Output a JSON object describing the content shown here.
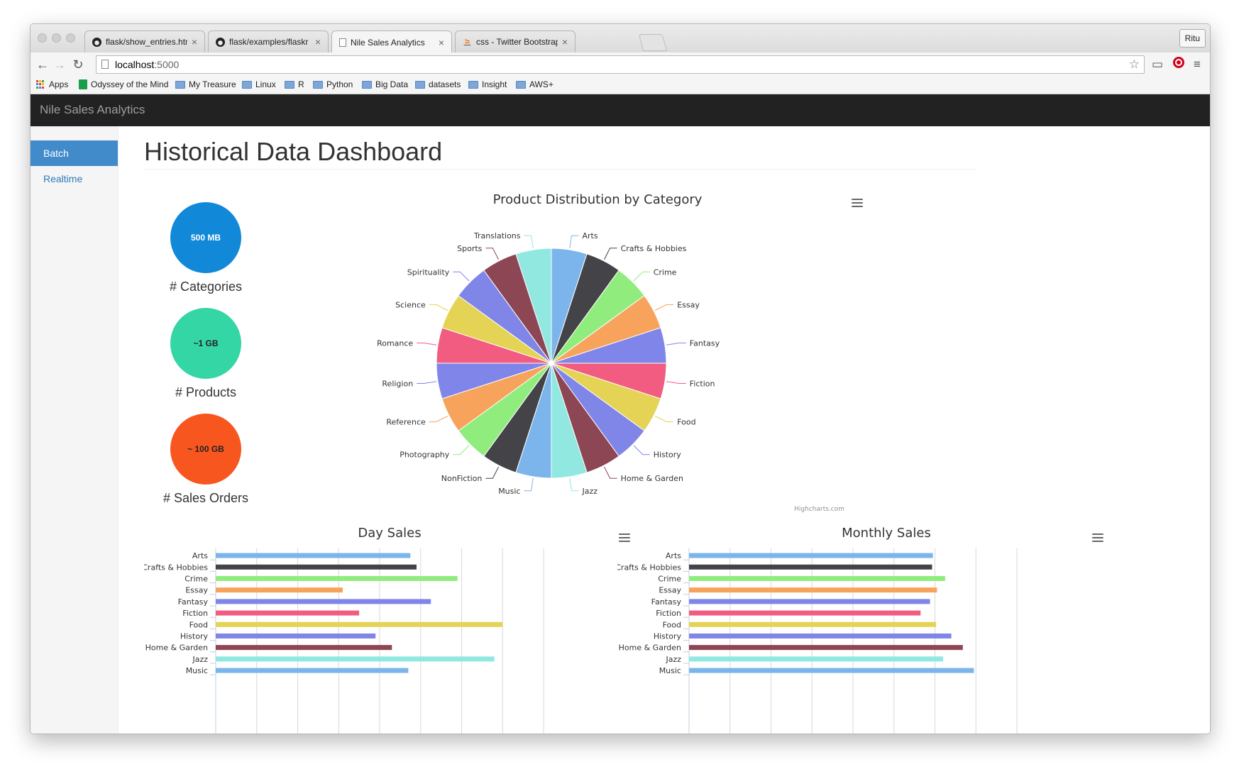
{
  "browser": {
    "tabs": [
      {
        "title": "flask/show_entries.html at",
        "icon": "github-icon"
      },
      {
        "title": "flask/examples/flaskr at m",
        "icon": "github-icon"
      },
      {
        "title": "Nile Sales Analytics",
        "icon": "page-icon",
        "active": true
      },
      {
        "title": "css - Twitter Bootstrap - ac",
        "icon": "stackoverflow-icon"
      }
    ],
    "profile": "Ritu",
    "url_host": "localhost",
    "url_port": ":5000",
    "bookmarks": [
      {
        "label": "Apps",
        "icon": "apps-grid-icon"
      },
      {
        "label": "Odyssey of the Mind",
        "icon": "sheets-icon"
      },
      {
        "label": "My Treasure",
        "icon": "folder-icon"
      },
      {
        "label": "Linux",
        "icon": "folder-icon"
      },
      {
        "label": "R",
        "icon": "folder-icon"
      },
      {
        "label": "Python",
        "icon": "folder-icon"
      },
      {
        "label": "Big Data",
        "icon": "folder-icon"
      },
      {
        "label": "datasets",
        "icon": "folder-icon"
      },
      {
        "label": "Insight",
        "icon": "folder-icon"
      },
      {
        "label": "AWS+",
        "icon": "folder-icon"
      }
    ]
  },
  "app": {
    "brand": "Nile Sales Analytics",
    "sidebar": [
      {
        "label": "Batch",
        "active": true
      },
      {
        "label": "Realtime",
        "active": false
      }
    ],
    "page_title": "Historical Data Dashboard",
    "stats": [
      {
        "value": "500 MB",
        "label": "# Categories",
        "color": "#1189d8"
      },
      {
        "value": "~1 GB",
        "label": "# Products",
        "color": "#35d6a6"
      },
      {
        "value": "~ 100 GB",
        "label": "# Sales Orders",
        "color": "#f7561f"
      }
    ],
    "credits": "Highcharts.com"
  },
  "colors": [
    "#7cb5ec",
    "#434348",
    "#90ed7d",
    "#f7a35c",
    "#8085e9",
    "#f15c80",
    "#e4d354",
    "#8085e8",
    "#8d4653",
    "#91e8e1"
  ],
  "chart_data": [
    {
      "type": "pie",
      "title": "Product Distribution by Category",
      "categories": [
        "Arts",
        "Crafts & Hobbies",
        "Crime",
        "Essay",
        "Fantasy",
        "Fiction",
        "Food",
        "History",
        "Home & Garden",
        "Jazz",
        "Music",
        "NonFiction",
        "Photography",
        "Reference",
        "Religion",
        "Romance",
        "Science",
        "Spirituality",
        "Sports",
        "Translations"
      ],
      "values": [
        5,
        5,
        5,
        5,
        5,
        5,
        5,
        5,
        5,
        5,
        5,
        5,
        5,
        5,
        5,
        5,
        5,
        5,
        5,
        5
      ]
    },
    {
      "type": "bar",
      "title": "Day Sales",
      "categories": [
        "Arts",
        "Crafts & Hobbies",
        "Crime",
        "Essay",
        "Fantasy",
        "Fiction",
        "Food",
        "History",
        "Home & Garden",
        "Jazz",
        "Music"
      ],
      "values": [
        4.75,
        4.9,
        5.9,
        3.1,
        5.25,
        3.5,
        7.0,
        3.9,
        4.3,
        6.8,
        4.7
      ],
      "xlim": [
        0,
        8
      ],
      "grid": true
    },
    {
      "type": "bar",
      "title": "Monthly Sales",
      "categories": [
        "Arts",
        "Crafts & Hobbies",
        "Crime",
        "Essay",
        "Fantasy",
        "Fiction",
        "Food",
        "History",
        "Home & Garden",
        "Jazz",
        "Music"
      ],
      "values": [
        5.95,
        5.93,
        6.25,
        6.05,
        5.88,
        5.65,
        6.03,
        6.4,
        6.68,
        6.2,
        6.95
      ],
      "xlim": [
        0,
        8
      ],
      "grid": true
    }
  ]
}
